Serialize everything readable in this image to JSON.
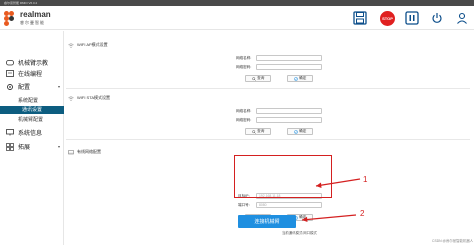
{
  "window": {
    "title": "睿尔曼智能 RMIO V6.0.2"
  },
  "brand": {
    "name": "realman",
    "sub": "睿尔曼智能",
    "accent": "#e85a20"
  },
  "toolbar": {
    "stop_label": "STOP"
  },
  "sidebar": {
    "items": [
      {
        "label": "机械臂示教",
        "icon": "gamepad-icon"
      },
      {
        "label": "在线编程",
        "icon": "code-icon"
      },
      {
        "label": "配置",
        "icon": "gear-icon"
      },
      {
        "label": "系统信息",
        "icon": "monitor-icon"
      },
      {
        "label": "拓展",
        "icon": "grid-icon"
      }
    ],
    "config_sub": [
      {
        "label": "系统配置"
      },
      {
        "label": "通讯设置"
      },
      {
        "label": "机械臂配置"
      }
    ]
  },
  "wifi_ap": {
    "title": "WIFI AP模式设置",
    "name_label": "网络名称:",
    "pass_label": "网络密码:",
    "query_label": "查询",
    "confirm_label": "确定"
  },
  "wifi_sta": {
    "title": "WIFI STA模式设置",
    "name_label": "网络名称:",
    "pass_label": "网络密码:",
    "query_label": "查询",
    "confirm_label": "确定"
  },
  "ethernet": {
    "title": "有线网络配置",
    "ip_label": "目标IP:",
    "ip_value": "192.168.11.18",
    "port_label": "端口号:",
    "port_value": "8080",
    "query_label": "查询",
    "confirm_label": "确定"
  },
  "annotations": {
    "num1": "1",
    "num2": "2",
    "color": "#d42020"
  },
  "connect": {
    "label": "连接机械臂",
    "hint": "当前通讯模式:网口模式"
  },
  "watermark": "CSDN @睿尔曼智能机器人"
}
